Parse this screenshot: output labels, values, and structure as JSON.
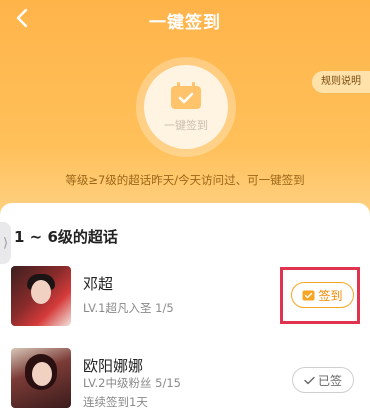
{
  "header": {
    "title": "一键签到",
    "back_icon": "chevron-left-icon"
  },
  "rules_label": "规则说明",
  "sign_all": {
    "label": "一键签到",
    "icon": "calendar-check-icon"
  },
  "description": "等级≥7级的超话昨天/今天访问过、可一键签到",
  "section_title": "1 ~ 6级的超话",
  "topics": [
    {
      "name": "邓超",
      "level_info": "LV.1超凡入圣 1/5",
      "action_label": "签到",
      "action_icon": "calendar-check-icon",
      "signed": false
    },
    {
      "name": "欧阳娜娜",
      "level_info": "LV.2中级粉丝 5/15",
      "streak": "连续签到1天",
      "action_label": "已签",
      "action_icon": "check-icon",
      "signed": true
    }
  ],
  "colors": {
    "accent": "#f08a00",
    "highlight": "#e0334f",
    "bg_top": "#ffb44a"
  }
}
